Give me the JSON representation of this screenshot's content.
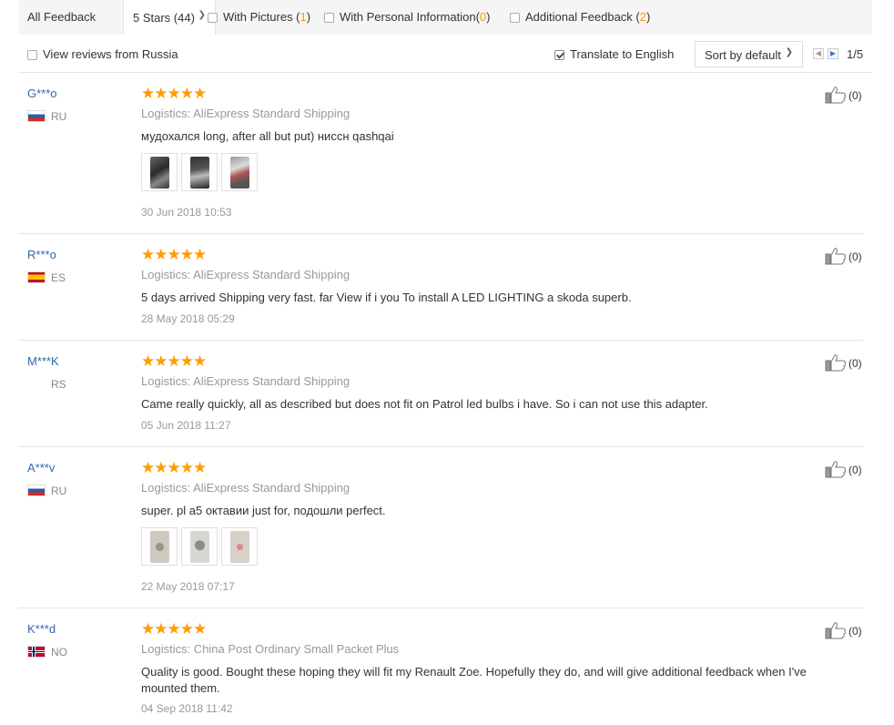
{
  "filters": {
    "all_feedback": "All Feedback",
    "stars_select": "5 Stars (44)",
    "with_pictures_label": "With Pictures (",
    "with_pictures_count": "1",
    "with_personal_label": "With Personal Information(",
    "with_personal_count": "0",
    "additional_label": "Additional Feedback (",
    "additional_count": "2",
    "paren_close": ")"
  },
  "options": {
    "view_russia": "View reviews from Russia",
    "translate": "Translate to English",
    "sort": "Sort by default",
    "page": "1/5"
  },
  "reviews": [
    {
      "user": "G***o",
      "country": "RU",
      "stars": "★★★★★",
      "logistics": "Logistics: AliExpress Standard Shipping",
      "text": "мудохался long, after all but put) ниссн qashqai",
      "date": "30 Jun 2018 10:53",
      "likes": "(0)"
    },
    {
      "user": "R***o",
      "country": "ES",
      "stars": "★★★★★",
      "logistics": "Logistics: AliExpress Standard Shipping",
      "text": "5 days arrived Shipping very fast. far View if i you To install A LED LIGHTING a skoda superb.",
      "date": "28 May 2018 05:29",
      "likes": "(0)"
    },
    {
      "user": "M***K",
      "country": "RS",
      "stars": "★★★★★",
      "logistics": "Logistics: AliExpress Standard Shipping",
      "text": "Came really quickly, all as described but does not fit on Patrol led bulbs i have. So i can not use this adapter.",
      "date": "05 Jun 2018 11:27",
      "likes": "(0)"
    },
    {
      "user": "A***v",
      "country": "RU",
      "stars": "★★★★★",
      "logistics": "Logistics: AliExpress Standard Shipping",
      "text": "super. pl a5 октавии just for, подошли perfect.",
      "date": "22 May 2018 07:17",
      "likes": "(0)"
    },
    {
      "user": "K***d",
      "country": "NO",
      "stars": "★★★★★",
      "logistics": "Logistics: China Post Ordinary Small Packet Plus",
      "text": "Quality is good. Bought these hoping they will fit my Renault Zoe. Hopefully they do, and will give additional feedback when I've mounted them.",
      "date": "04 Sep 2018 11:42",
      "likes": "(0)"
    }
  ],
  "icons": {
    "star": "star-icon",
    "thumbs_up": "thumbs-up-icon",
    "checkbox": "checkbox-icon",
    "chevron": "chevron-down-icon"
  },
  "colors": {
    "star": "#ff9c00",
    "username": "#3366aa",
    "count_highlight": "#ff9900",
    "muted": "#999999"
  }
}
